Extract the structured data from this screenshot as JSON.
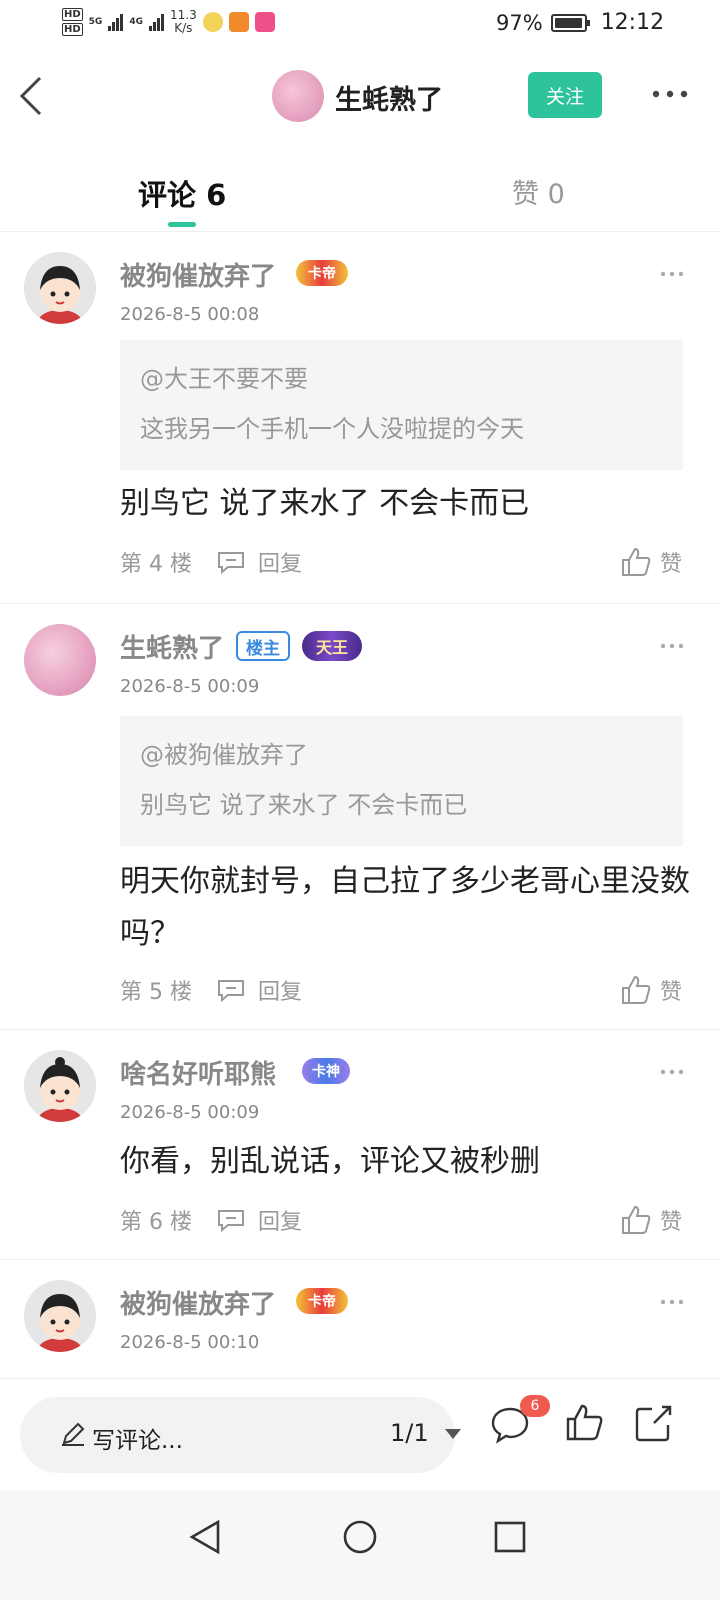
{
  "status_bar": {
    "hd1": "HD",
    "hd2": "HD",
    "net1": "5G",
    "net2": "4G",
    "speed": "11.3",
    "speed_unit": "K/s",
    "battery": "97%",
    "battery_level": 0.97,
    "time": "12:12"
  },
  "header": {
    "username": "生蚝熟了",
    "follow_label": "关注"
  },
  "tabs": {
    "comments_label": "评论 6",
    "likes_label": "赞 0"
  },
  "comments": [
    {
      "user": "被狗催放弃了",
      "badge": "卡帝",
      "time": "2026-8-5 00:08",
      "quote_user": "@大王不要不要",
      "quote_text": "这我另一个手机一个人没啦提的今天",
      "text": "别鸟它 说了来水了 不会卡而已",
      "floor": "第 4 楼",
      "reply_label": "回复",
      "like_label": "赞"
    },
    {
      "user": "生蚝熟了",
      "host_badge": "楼主",
      "badge": "天王",
      "time": "2026-8-5 00:09",
      "quote_user": "@被狗催放弃了",
      "quote_text": "别鸟它 说了来水了 不会卡而已",
      "text": "明天你就封号，自己拉了多少老哥心里没数吗？",
      "floor": "第 5 楼",
      "reply_label": "回复",
      "like_label": "赞"
    },
    {
      "user": "啥名好听耶熊",
      "badge": "卡神",
      "time": "2026-8-5 00:09",
      "text": "你看，别乱说话，评论又被秒删",
      "floor": "第 6 楼",
      "reply_label": "回复",
      "like_label": "赞"
    },
    {
      "user": "被狗催放弃了",
      "badge": "卡帝",
      "time": "2026-8-5 00:10"
    }
  ],
  "bottom_bar": {
    "write_placeholder": "写评论...",
    "page_indicator": "1/1",
    "comment_count": "6"
  },
  "icons": {
    "back": "back-arrow-icon",
    "more": "more-dots-icon",
    "reply": "reply-bubble-icon",
    "like": "thumbs-up-icon",
    "comment": "comment-bubble-icon",
    "share": "share-icon",
    "edit": "pencil-icon"
  },
  "colors": {
    "accent": "#2ec39a",
    "badge_red": "#f05a4f",
    "host_blue": "#3a8be0"
  }
}
